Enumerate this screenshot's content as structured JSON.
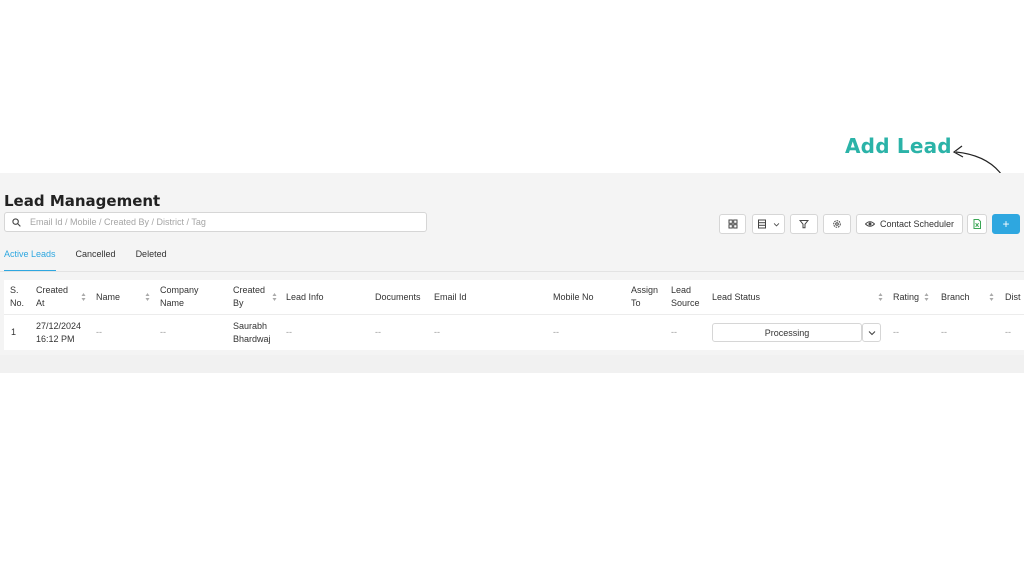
{
  "annotation": {
    "text": "Add Lead"
  },
  "page": {
    "title": "Lead Management"
  },
  "search": {
    "placeholder": "Email Id / Mobile / Created By / District / Tag",
    "value": ""
  },
  "toolbar": {
    "contact_scheduler_label": "Contact Scheduler",
    "add_label": "+"
  },
  "tabs": [
    {
      "label": "Active Leads",
      "active": true
    },
    {
      "label": "Cancelled",
      "active": false
    },
    {
      "label": "Deleted",
      "active": false
    }
  ],
  "table": {
    "headers": [
      {
        "key": "sno",
        "label": "S. No."
      },
      {
        "key": "created_at",
        "label": "Created At"
      },
      {
        "key": "name",
        "label": "Name"
      },
      {
        "key": "company_name",
        "label": "Company Name"
      },
      {
        "key": "created_by",
        "label": "Created By"
      },
      {
        "key": "lead_info",
        "label": "Lead Info"
      },
      {
        "key": "documents",
        "label": "Documents"
      },
      {
        "key": "email_id",
        "label": "Email Id"
      },
      {
        "key": "mobile_no",
        "label": "Mobile No"
      },
      {
        "key": "assign_to",
        "label": "Assign To"
      },
      {
        "key": "lead_source",
        "label": "Lead Source"
      },
      {
        "key": "lead_status",
        "label": "Lead Status"
      },
      {
        "key": "rating",
        "label": "Rating"
      },
      {
        "key": "branch",
        "label": "Branch"
      },
      {
        "key": "district",
        "label": "Dist"
      }
    ],
    "rows": [
      {
        "sno": "1",
        "created_at": "27/12/2024 16:12 PM",
        "name": "--",
        "company_name": "--",
        "created_by": "Saurabh Bhardwaj",
        "lead_info": "--",
        "documents": "--",
        "email_id": "--",
        "mobile_no": "--",
        "assign_to": "",
        "lead_source": "--",
        "lead_status": "Processing",
        "rating": "--",
        "branch": "--",
        "district": "--"
      }
    ]
  },
  "colors": {
    "accent": "#2ea7e0",
    "annotation": "#2bb3a8",
    "export": "#3aa655"
  }
}
